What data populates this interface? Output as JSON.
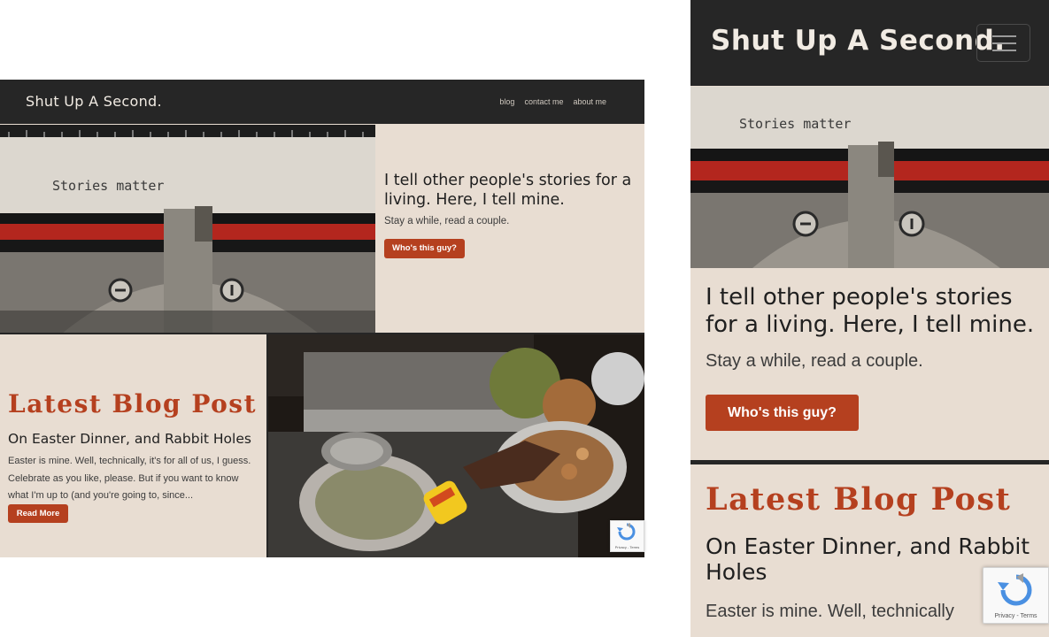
{
  "site": {
    "brand": "Shut Up A Second."
  },
  "desktop": {
    "nav": {
      "links": [
        "blog",
        "contact me",
        "about me"
      ]
    },
    "hero": {
      "image_text": "Stories matter",
      "title": "I tell other people's stories for a living. Here, I tell mine.",
      "subtitle": "Stay a while, read a couple.",
      "button": "Who's this guy?"
    },
    "blog": {
      "heading": "Latest Blog Post",
      "post_title": "On Easter Dinner, and Rabbit Holes",
      "excerpt": "Easter is mine.   Well, technically, it's for all of us, I guess. Celebrate as you like, please.  But if you want to know what I'm up to (and you're going to, since...",
      "button": "Read More"
    },
    "recaptcha": {
      "label": "Privacy - Terms"
    }
  },
  "mobile": {
    "hero": {
      "image_text": "Stories matter",
      "title": "I tell other people's stories for a living. Here, I tell mine.",
      "subtitle": "Stay a while, read a couple.",
      "button": "Who's this guy?"
    },
    "blog": {
      "heading": "Latest Blog Post",
      "post_title": "On Easter Dinner, and Rabbit Holes",
      "excerpt": "Easter is mine.   Well, technically"
    },
    "recaptcha": {
      "label": "Privacy - Terms"
    }
  },
  "colors": {
    "nav_bg": "#262626",
    "page_bg": "#e8ddd2",
    "accent": "#b5401f",
    "ribbon": "#b3261e"
  }
}
